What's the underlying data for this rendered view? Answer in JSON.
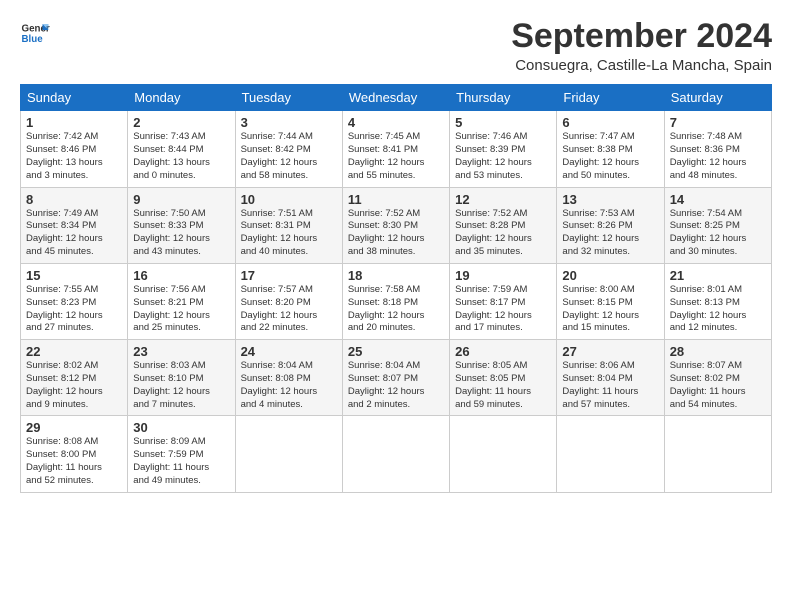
{
  "logo": {
    "line1": "General",
    "line2": "Blue"
  },
  "title": "September 2024",
  "location": "Consuegra, Castille-La Mancha, Spain",
  "days_of_week": [
    "Sunday",
    "Monday",
    "Tuesday",
    "Wednesday",
    "Thursday",
    "Friday",
    "Saturday"
  ],
  "weeks": [
    [
      {
        "day": "1",
        "info": "Sunrise: 7:42 AM\nSunset: 8:46 PM\nDaylight: 13 hours\nand 3 minutes."
      },
      {
        "day": "2",
        "info": "Sunrise: 7:43 AM\nSunset: 8:44 PM\nDaylight: 13 hours\nand 0 minutes."
      },
      {
        "day": "3",
        "info": "Sunrise: 7:44 AM\nSunset: 8:42 PM\nDaylight: 12 hours\nand 58 minutes."
      },
      {
        "day": "4",
        "info": "Sunrise: 7:45 AM\nSunset: 8:41 PM\nDaylight: 12 hours\nand 55 minutes."
      },
      {
        "day": "5",
        "info": "Sunrise: 7:46 AM\nSunset: 8:39 PM\nDaylight: 12 hours\nand 53 minutes."
      },
      {
        "day": "6",
        "info": "Sunrise: 7:47 AM\nSunset: 8:38 PM\nDaylight: 12 hours\nand 50 minutes."
      },
      {
        "day": "7",
        "info": "Sunrise: 7:48 AM\nSunset: 8:36 PM\nDaylight: 12 hours\nand 48 minutes."
      }
    ],
    [
      {
        "day": "8",
        "info": "Sunrise: 7:49 AM\nSunset: 8:34 PM\nDaylight: 12 hours\nand 45 minutes."
      },
      {
        "day": "9",
        "info": "Sunrise: 7:50 AM\nSunset: 8:33 PM\nDaylight: 12 hours\nand 43 minutes."
      },
      {
        "day": "10",
        "info": "Sunrise: 7:51 AM\nSunset: 8:31 PM\nDaylight: 12 hours\nand 40 minutes."
      },
      {
        "day": "11",
        "info": "Sunrise: 7:52 AM\nSunset: 8:30 PM\nDaylight: 12 hours\nand 38 minutes."
      },
      {
        "day": "12",
        "info": "Sunrise: 7:52 AM\nSunset: 8:28 PM\nDaylight: 12 hours\nand 35 minutes."
      },
      {
        "day": "13",
        "info": "Sunrise: 7:53 AM\nSunset: 8:26 PM\nDaylight: 12 hours\nand 32 minutes."
      },
      {
        "day": "14",
        "info": "Sunrise: 7:54 AM\nSunset: 8:25 PM\nDaylight: 12 hours\nand 30 minutes."
      }
    ],
    [
      {
        "day": "15",
        "info": "Sunrise: 7:55 AM\nSunset: 8:23 PM\nDaylight: 12 hours\nand 27 minutes."
      },
      {
        "day": "16",
        "info": "Sunrise: 7:56 AM\nSunset: 8:21 PM\nDaylight: 12 hours\nand 25 minutes."
      },
      {
        "day": "17",
        "info": "Sunrise: 7:57 AM\nSunset: 8:20 PM\nDaylight: 12 hours\nand 22 minutes."
      },
      {
        "day": "18",
        "info": "Sunrise: 7:58 AM\nSunset: 8:18 PM\nDaylight: 12 hours\nand 20 minutes."
      },
      {
        "day": "19",
        "info": "Sunrise: 7:59 AM\nSunset: 8:17 PM\nDaylight: 12 hours\nand 17 minutes."
      },
      {
        "day": "20",
        "info": "Sunrise: 8:00 AM\nSunset: 8:15 PM\nDaylight: 12 hours\nand 15 minutes."
      },
      {
        "day": "21",
        "info": "Sunrise: 8:01 AM\nSunset: 8:13 PM\nDaylight: 12 hours\nand 12 minutes."
      }
    ],
    [
      {
        "day": "22",
        "info": "Sunrise: 8:02 AM\nSunset: 8:12 PM\nDaylight: 12 hours\nand 9 minutes."
      },
      {
        "day": "23",
        "info": "Sunrise: 8:03 AM\nSunset: 8:10 PM\nDaylight: 12 hours\nand 7 minutes."
      },
      {
        "day": "24",
        "info": "Sunrise: 8:04 AM\nSunset: 8:08 PM\nDaylight: 12 hours\nand 4 minutes."
      },
      {
        "day": "25",
        "info": "Sunrise: 8:04 AM\nSunset: 8:07 PM\nDaylight: 12 hours\nand 2 minutes."
      },
      {
        "day": "26",
        "info": "Sunrise: 8:05 AM\nSunset: 8:05 PM\nDaylight: 11 hours\nand 59 minutes."
      },
      {
        "day": "27",
        "info": "Sunrise: 8:06 AM\nSunset: 8:04 PM\nDaylight: 11 hours\nand 57 minutes."
      },
      {
        "day": "28",
        "info": "Sunrise: 8:07 AM\nSunset: 8:02 PM\nDaylight: 11 hours\nand 54 minutes."
      }
    ],
    [
      {
        "day": "29",
        "info": "Sunrise: 8:08 AM\nSunset: 8:00 PM\nDaylight: 11 hours\nand 52 minutes."
      },
      {
        "day": "30",
        "info": "Sunrise: 8:09 AM\nSunset: 7:59 PM\nDaylight: 11 hours\nand 49 minutes."
      },
      {
        "day": "",
        "info": ""
      },
      {
        "day": "",
        "info": ""
      },
      {
        "day": "",
        "info": ""
      },
      {
        "day": "",
        "info": ""
      },
      {
        "day": "",
        "info": ""
      }
    ]
  ]
}
